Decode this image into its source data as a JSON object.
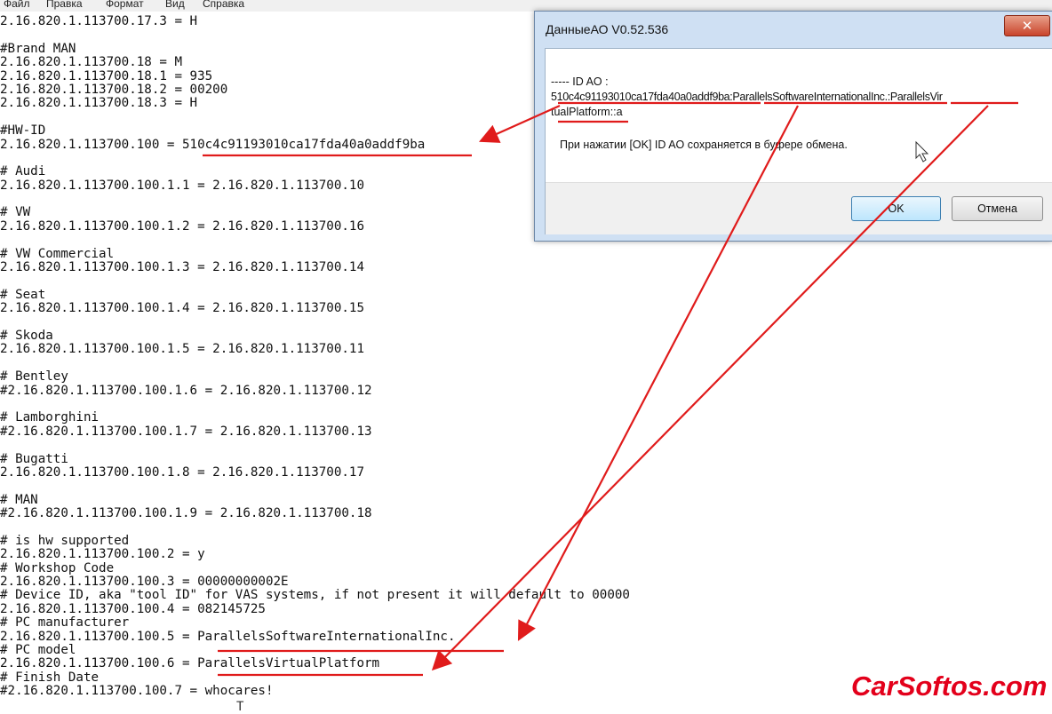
{
  "menu": [
    "Файл",
    "Правка",
    "Формат",
    "Вид",
    "Справка"
  ],
  "code_lines": [
    "2.16.820.1.113700.17.3 = H",
    "",
    "#Brand MAN",
    "2.16.820.1.113700.18 = M",
    "2.16.820.1.113700.18.1 = 935",
    "2.16.820.1.113700.18.2 = 00200",
    "2.16.820.1.113700.18.3 = H",
    "",
    "#HW-ID",
    "2.16.820.1.113700.100 = 510c4c91193010ca17fda40a0addf9ba",
    "",
    "# Audi",
    "2.16.820.1.113700.100.1.1 = 2.16.820.1.113700.10",
    "",
    "# VW",
    "2.16.820.1.113700.100.1.2 = 2.16.820.1.113700.16",
    "",
    "# VW Commercial",
    "2.16.820.1.113700.100.1.3 = 2.16.820.1.113700.14",
    "",
    "# Seat",
    "2.16.820.1.113700.100.1.4 = 2.16.820.1.113700.15",
    "",
    "# Skoda",
    "2.16.820.1.113700.100.1.5 = 2.16.820.1.113700.11",
    "",
    "# Bentley",
    "#2.16.820.1.113700.100.1.6 = 2.16.820.1.113700.12",
    "",
    "# Lamborghini",
    "#2.16.820.1.113700.100.1.7 = 2.16.820.1.113700.13",
    "",
    "# Bugatti",
    "2.16.820.1.113700.100.1.8 = 2.16.820.1.113700.17",
    "",
    "# MAN",
    "#2.16.820.1.113700.100.1.9 = 2.16.820.1.113700.18",
    "",
    "# is hw supported",
    "2.16.820.1.113700.100.2 = y",
    "# Workshop Code",
    "2.16.820.1.113700.100.3 = 00000000002E",
    "# Device ID, aka \"tool ID\" for VAS systems, if not present it will default to 00000",
    "2.16.820.1.113700.100.4 = 082145725",
    "# PC manufacturer",
    "2.16.820.1.113700.100.5 = ParallelsSoftwareInternationalInc.",
    "# PC model",
    "2.16.820.1.113700.100.6 = ParallelsVirtualPlatform",
    "# Finish Date",
    "#2.16.820.1.113700.100.7 = whocares!"
  ],
  "dialog": {
    "title": "ДанныеАО V0.52.536",
    "close_glyph": "✕",
    "id_header": "----- ID AO :",
    "id_line1": "510c4c91193010ca17fda40a0addf9ba:ParallelsSoftwareInternationalInc.:ParallelsVir",
    "id_line2": "tualPlatform::a",
    "info": "При нажатии [OK] ID AO сохраняется в буфере обмена.",
    "ok_label": "OK",
    "cancel_label": "Отмена"
  },
  "watermark": "CarSoftos.com",
  "annotation_color": "#e01b1b"
}
